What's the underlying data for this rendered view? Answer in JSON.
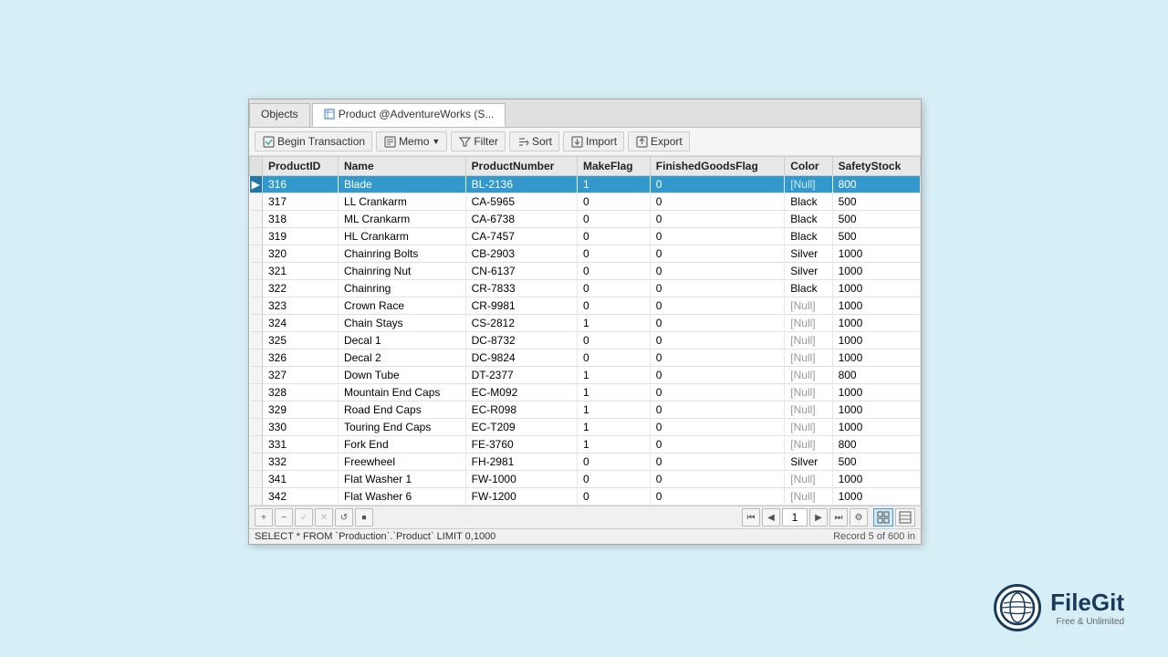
{
  "tabs": [
    {
      "id": "objects",
      "label": "Objects",
      "active": false
    },
    {
      "id": "product",
      "label": "Product @AdventureWorks (S...",
      "active": true
    }
  ],
  "toolbar": {
    "begin_transaction": "Begin Transaction",
    "memo": "Memo",
    "filter": "Filter",
    "sort": "Sort",
    "import": "Import",
    "export": "Export"
  },
  "columns": [
    "ProductID",
    "Name",
    "ProductNumber",
    "MakeFlag",
    "FinishedGoodsFlag",
    "Color",
    "SafetyStock"
  ],
  "rows": [
    {
      "id": 316,
      "name": "Blade",
      "number": "BL-2136",
      "make": 1,
      "finished": 0,
      "color": "[Null]",
      "safety": 800,
      "selected": true
    },
    {
      "id": 317,
      "name": "LL Crankarm",
      "number": "CA-5965",
      "make": 0,
      "finished": 0,
      "color": "Black",
      "safety": 500,
      "selected": false
    },
    {
      "id": 318,
      "name": "ML Crankarm",
      "number": "CA-6738",
      "make": 0,
      "finished": 0,
      "color": "Black",
      "safety": 500,
      "selected": false
    },
    {
      "id": 319,
      "name": "HL Crankarm",
      "number": "CA-7457",
      "make": 0,
      "finished": 0,
      "color": "Black",
      "safety": 500,
      "selected": false
    },
    {
      "id": 320,
      "name": "Chainring Bolts",
      "number": "CB-2903",
      "make": 0,
      "finished": 0,
      "color": "Silver",
      "safety": 1000,
      "selected": false
    },
    {
      "id": 321,
      "name": "Chainring Nut",
      "number": "CN-6137",
      "make": 0,
      "finished": 0,
      "color": "Silver",
      "safety": 1000,
      "selected": false
    },
    {
      "id": 322,
      "name": "Chainring",
      "number": "CR-7833",
      "make": 0,
      "finished": 0,
      "color": "Black",
      "safety": 1000,
      "selected": false
    },
    {
      "id": 323,
      "name": "Crown Race",
      "number": "CR-9981",
      "make": 0,
      "finished": 0,
      "color": "[Null]",
      "safety": 1000,
      "selected": false
    },
    {
      "id": 324,
      "name": "Chain Stays",
      "number": "CS-2812",
      "make": 1,
      "finished": 0,
      "color": "[Null]",
      "safety": 1000,
      "selected": false
    },
    {
      "id": 325,
      "name": "Decal 1",
      "number": "DC-8732",
      "make": 0,
      "finished": 0,
      "color": "[Null]",
      "safety": 1000,
      "selected": false
    },
    {
      "id": 326,
      "name": "Decal 2",
      "number": "DC-9824",
      "make": 0,
      "finished": 0,
      "color": "[Null]",
      "safety": 1000,
      "selected": false
    },
    {
      "id": 327,
      "name": "Down Tube",
      "number": "DT-2377",
      "make": 1,
      "finished": 0,
      "color": "[Null]",
      "safety": 800,
      "selected": false
    },
    {
      "id": 328,
      "name": "Mountain End Caps",
      "number": "EC-M092",
      "make": 1,
      "finished": 0,
      "color": "[Null]",
      "safety": 1000,
      "selected": false
    },
    {
      "id": 329,
      "name": "Road End Caps",
      "number": "EC-R098",
      "make": 1,
      "finished": 0,
      "color": "[Null]",
      "safety": 1000,
      "selected": false
    },
    {
      "id": 330,
      "name": "Touring End Caps",
      "number": "EC-T209",
      "make": 1,
      "finished": 0,
      "color": "[Null]",
      "safety": 1000,
      "selected": false
    },
    {
      "id": 331,
      "name": "Fork End",
      "number": "FE-3760",
      "make": 1,
      "finished": 0,
      "color": "[Null]",
      "safety": 800,
      "selected": false
    },
    {
      "id": 332,
      "name": "Freewheel",
      "number": "FH-2981",
      "make": 0,
      "finished": 0,
      "color": "Silver",
      "safety": 500,
      "selected": false
    },
    {
      "id": 341,
      "name": "Flat Washer 1",
      "number": "FW-1000",
      "make": 0,
      "finished": 0,
      "color": "[Null]",
      "safety": 1000,
      "selected": false
    },
    {
      "id": 342,
      "name": "Flat Washer 6",
      "number": "FW-1200",
      "make": 0,
      "finished": 0,
      "color": "[Null]",
      "safety": 1000,
      "selected": false
    }
  ],
  "pagination": {
    "current_page": "1",
    "record_info": "Record 5 of 600 in"
  },
  "statusbar": {
    "query": "SELECT * FROM `Production`.`Product` LIMIT 0,1000"
  },
  "logo": {
    "name": "FileGit",
    "tagline": "Free & Unlimited"
  }
}
